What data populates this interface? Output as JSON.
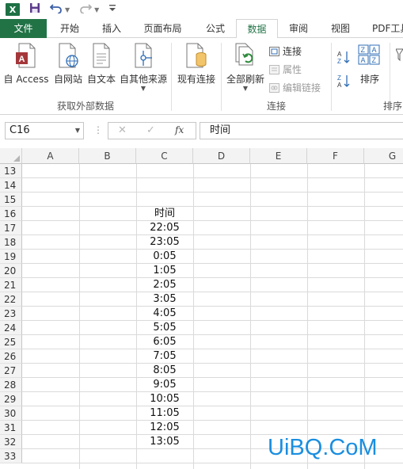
{
  "qat": {
    "logo": "X"
  },
  "tabs": [
    "文件",
    "开始",
    "插入",
    "页面布局",
    "公式",
    "数据",
    "审阅",
    "视图",
    "PDF工具"
  ],
  "ribbon": {
    "get_external": {
      "label": "获取外部数据",
      "buttons": [
        "自 Access",
        "自网站",
        "自文本",
        "自其他来源"
      ]
    },
    "existing": "现有连接",
    "connections": {
      "label": "连接",
      "refresh_all": "全部刷新",
      "connect": "连接",
      "properties": "属性",
      "edit_links": "编辑链接"
    },
    "sort_filter": {
      "label": "排序",
      "sort": "排序"
    }
  },
  "formula_bar": {
    "name_box": "C16",
    "value": "时间",
    "fx": "fx"
  },
  "grid": {
    "columns": [
      "A",
      "B",
      "C",
      "D",
      "E",
      "F",
      "G"
    ],
    "rows": [
      "13",
      "14",
      "15",
      "16",
      "17",
      "18",
      "19",
      "20",
      "21",
      "22",
      "23",
      "24",
      "25",
      "26",
      "27",
      "28",
      "29",
      "30",
      "31",
      "32",
      "33"
    ],
    "c_values": [
      "",
      "",
      "",
      "时间",
      "22:05",
      "23:05",
      "0:05",
      "1:05",
      "2:05",
      "3:05",
      "4:05",
      "5:05",
      "6:05",
      "7:05",
      "8:05",
      "9:05",
      "10:05",
      "11:05",
      "12:05",
      "13:05",
      ""
    ]
  },
  "watermark": "UiBQ.CoM",
  "colors": {
    "accent": "#217346",
    "watermark": "#1a8ee0"
  }
}
